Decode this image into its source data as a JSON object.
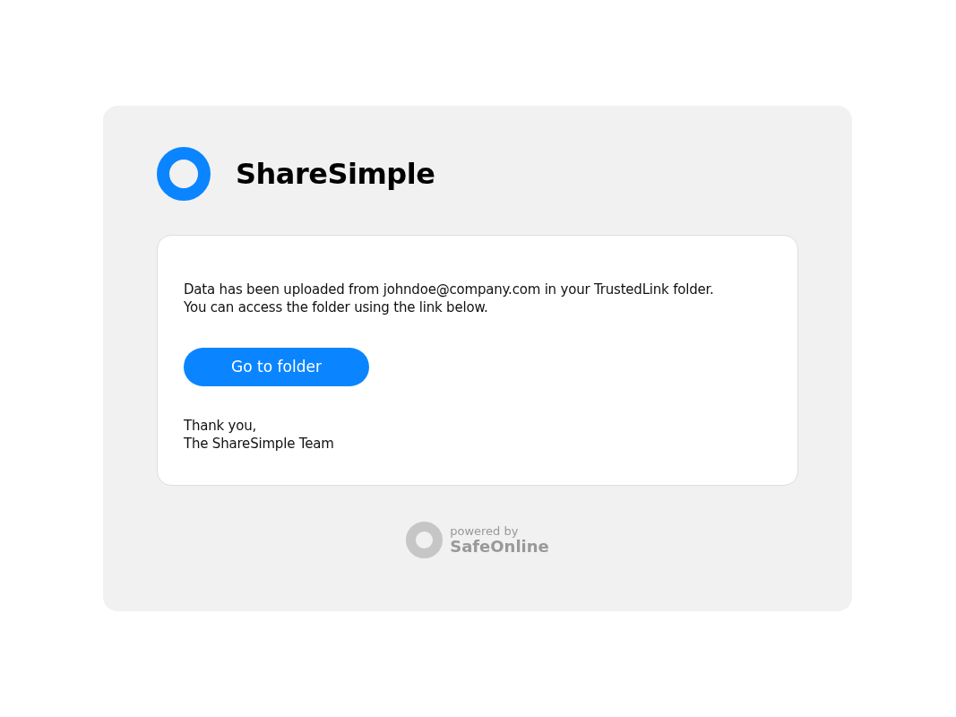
{
  "brand": {
    "name": "ShareSimple"
  },
  "message": {
    "lines": [
      "Data has been uploaded from johndoe@company.com in your TrustedLink folder.",
      "You can access the folder using the link below."
    ]
  },
  "button": {
    "label": "Go to folder"
  },
  "signoff": {
    "lines": [
      "Thank you,",
      "The ShareSimple Team"
    ]
  },
  "footer": {
    "powered_by": "powered by",
    "name": "SafeOnline"
  }
}
